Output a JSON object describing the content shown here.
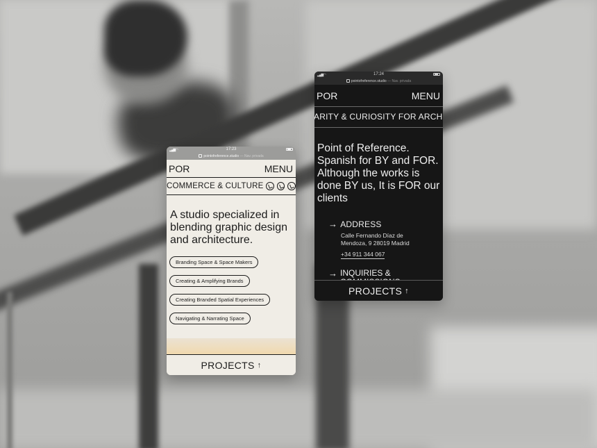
{
  "status": {
    "light_time": "17:23",
    "dark_time": "17:24"
  },
  "urlbar": {
    "domain": "pointofreference.studio",
    "suffix": "— Nav. privada"
  },
  "nav": {
    "logo": "POR",
    "menu": "MENU"
  },
  "light_phone": {
    "marquee": "COMMERCE & CULTURE",
    "headline": "A studio specialized in blending graphic design and architecture.",
    "pills": [
      "Branding Space & Space Makers",
      "Creating & Amplifying Brands",
      "Creating Branded Spatial Experiences",
      "Navigating & Narrating Space"
    ],
    "projects": "PROJECTS"
  },
  "dark_phone": {
    "marquee": "ARITY & CURIOSITY FOR ARCHIT",
    "headline": "Point of Reference. Spanish for BY and FOR. Although the works is done BY us, It is FOR our clients",
    "address_heading": "ADDRESS",
    "address_line1": "Calle Fernando Díaz de",
    "address_line2": "Mendoza, 9 28019 Madrid",
    "phone": "+34 911 344 067",
    "inquiries_heading": "INQUIRIES & COMMISSIONS",
    "projects": "PROJECTS"
  },
  "icons": {
    "arrow_up": "↑",
    "arrow_right": "→"
  }
}
